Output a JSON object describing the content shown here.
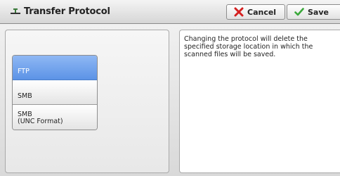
{
  "header": {
    "title": "Transfer Protocol",
    "icon": "transfer-protocol-icon",
    "cancel_label": "Cancel",
    "save_label": "Save"
  },
  "options": [
    {
      "label": "FTP",
      "selected": true
    },
    {
      "label": "SMB",
      "selected": false
    },
    {
      "label": "SMB\n(UNC Format)",
      "selected": false
    }
  ],
  "message": "Changing the protocol will delete the specified storage location in which the scanned files will be saved.",
  "colors": {
    "selected_option": "#6a9ee8",
    "cancel_icon": "#d42020",
    "save_icon": "#3aa83a"
  }
}
